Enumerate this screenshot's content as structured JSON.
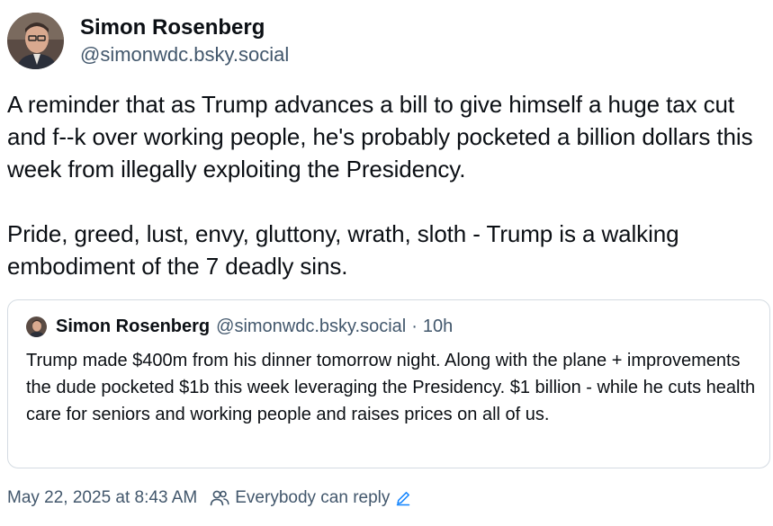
{
  "post": {
    "author": {
      "display_name": "Simon Rosenberg",
      "handle": "@simonwdc.bsky.social",
      "avatar_icon": "person-photo-avatar"
    },
    "text_paragraphs": [
      "A reminder that as Trump advances a bill to give himself a huge tax cut and f--k over working people, he's probably pocketed a billion dollars this week from illegally exploiting the Presidency.",
      "Pride, greed, lust, envy, gluttony, wrath, sloth - Trump is a walking embodiment of the 7 deadly sins."
    ],
    "quote": {
      "display_name": "Simon Rosenberg",
      "handle": "@simonwdc.bsky.social",
      "separator": "·",
      "time": "10h",
      "text": "Trump made $400m from his dinner tomorrow night.  Along with the plane + improvements the dude pocketed $1b this week leveraging the Presidency. $1 billion - while he cuts health care for seniors and working people and raises prices on all of us."
    },
    "meta": {
      "timestamp": "May 22, 2025 at 8:43 AM",
      "reply_setting": "Everybody can reply",
      "reply_icon": "people-icon",
      "edit_icon": "pencil-icon"
    }
  },
  "colors": {
    "text": "#0b0f14",
    "muted": "#42576c",
    "border": "#d4dbe2",
    "accent": "#1083fe"
  }
}
